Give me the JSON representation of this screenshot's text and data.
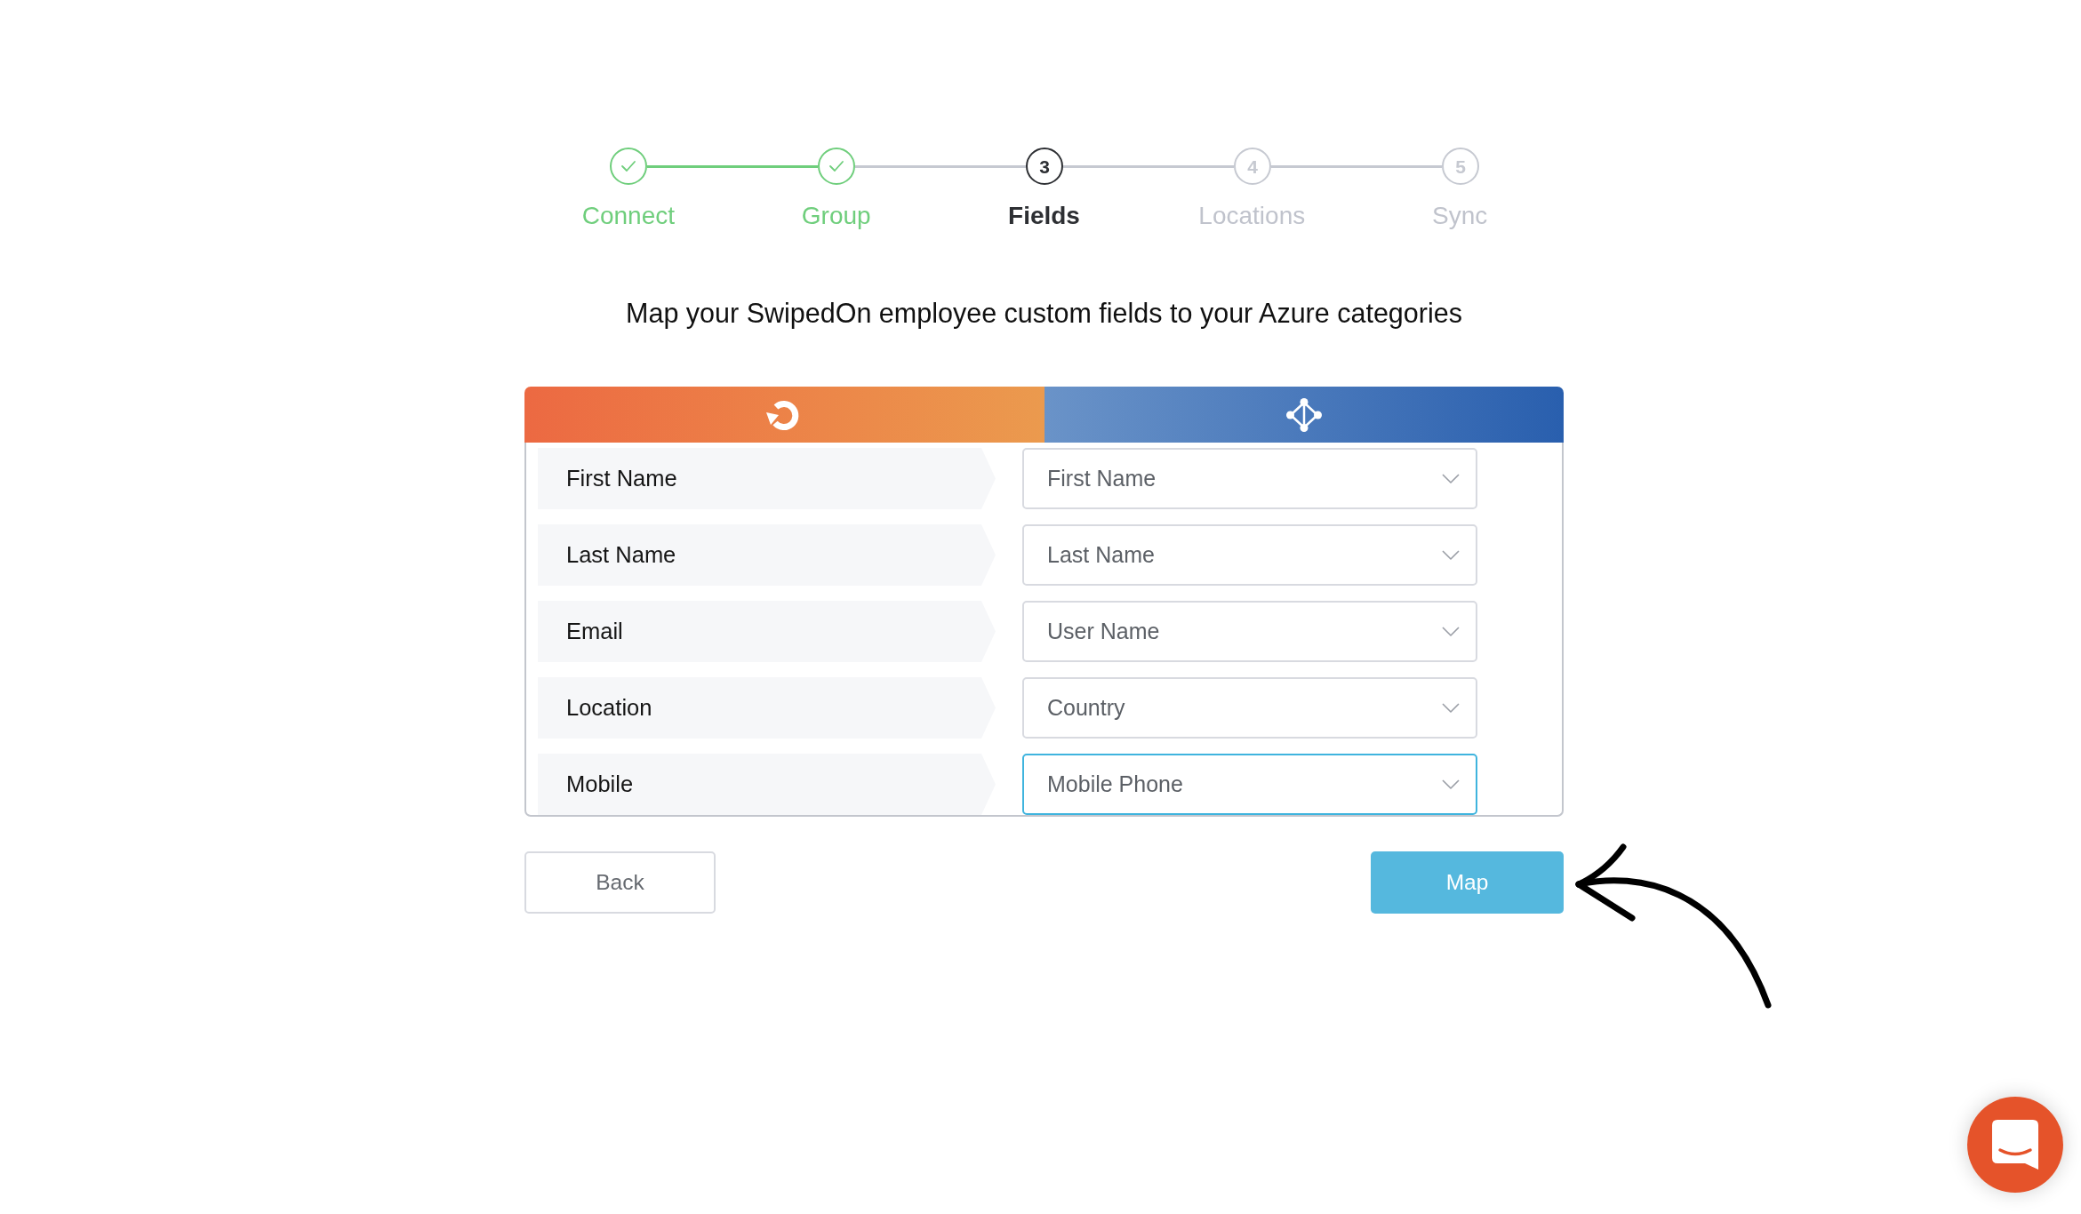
{
  "stepper": {
    "steps": [
      {
        "label": "Connect",
        "completed": true,
        "selected": false
      },
      {
        "label": "Group",
        "completed": true,
        "selected": false
      },
      {
        "label": "Fields",
        "completed": false,
        "selected": true,
        "number": "3"
      },
      {
        "label": "Locations",
        "completed": false,
        "selected": false,
        "number": "4"
      },
      {
        "label": "Sync",
        "completed": false,
        "selected": false,
        "number": "5"
      }
    ]
  },
  "heading": "Map your SwipedOn employee custom fields to your Azure categories",
  "mapping_table": {
    "rows": [
      {
        "field": "First Name",
        "mapped_to": "First Name",
        "focused": false
      },
      {
        "field": "Last Name",
        "mapped_to": "Last Name",
        "focused": false
      },
      {
        "field": "Email",
        "mapped_to": "User Name",
        "focused": false
      },
      {
        "field": "Location",
        "mapped_to": "Country",
        "focused": false
      },
      {
        "field": "Mobile",
        "mapped_to": "Mobile Phone",
        "focused": true
      }
    ]
  },
  "actions": [
    {
      "label": "Back",
      "kind": "secondary"
    },
    {
      "label": "Map",
      "kind": "primary"
    }
  ]
}
